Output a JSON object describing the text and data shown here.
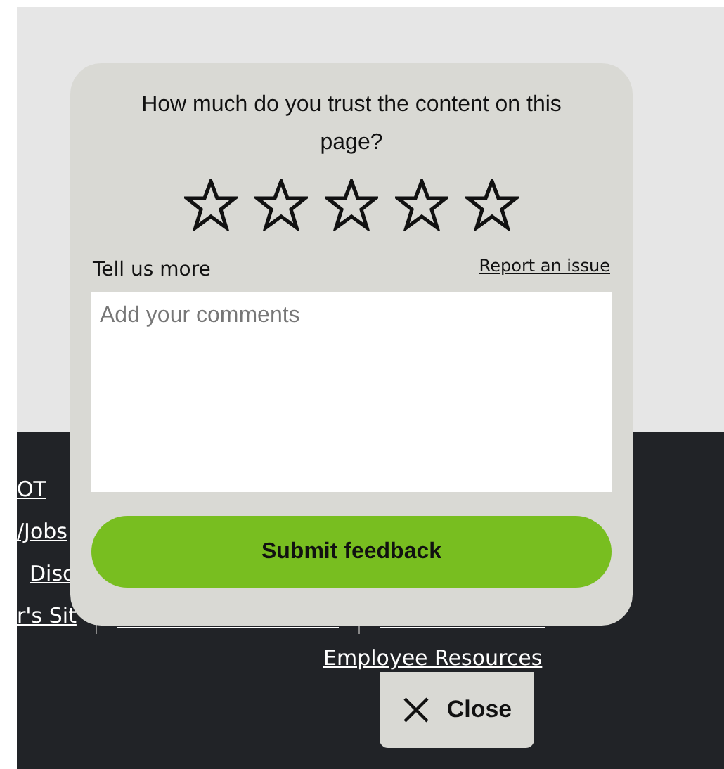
{
  "footer": {
    "links": [
      {
        "text": "OT"
      },
      {
        "text": "/Jobs"
      },
      {
        "text": "Disc"
      },
      {
        "text": "r's Sit"
      }
    ],
    "bottom_link": "Employee Resources"
  },
  "feedback": {
    "question": "How much do you trust the content on this page?",
    "rating": {
      "stars": 0
    },
    "comment_label": "Tell us more",
    "report_link": "Report an issue",
    "comment_placeholder": "Add your comments",
    "submit": "Submit feedback"
  },
  "close": {
    "label": "Close"
  }
}
